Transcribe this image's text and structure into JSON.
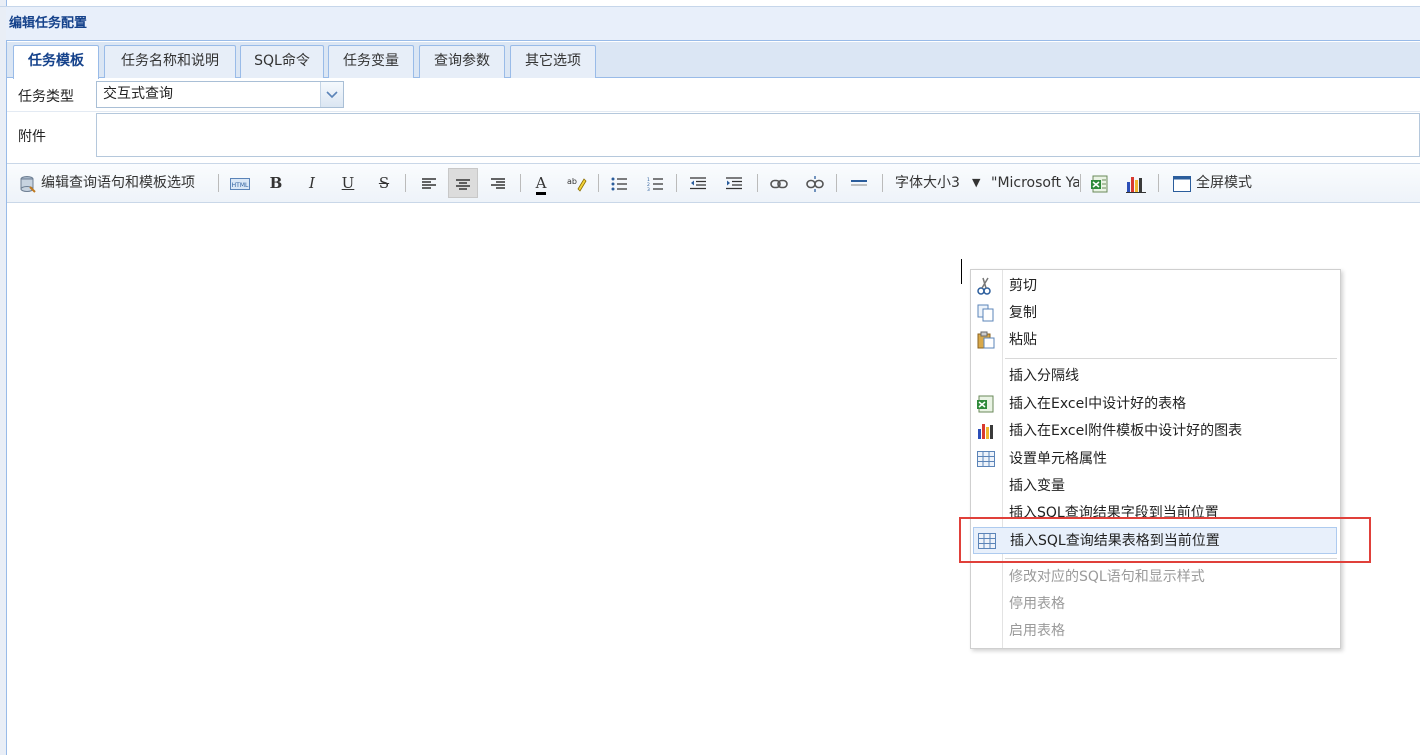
{
  "panel": {
    "title": "编辑任务配置"
  },
  "tabs": [
    {
      "label": "任务模板",
      "active": true
    },
    {
      "label": "任务名称和说明"
    },
    {
      "label": "SQL命令"
    },
    {
      "label": "任务变量"
    },
    {
      "label": "查询参数"
    },
    {
      "label": "其它选项"
    }
  ],
  "form": {
    "task_type_label": "任务类型",
    "task_type_value": "交互式查询",
    "attachment_label": "附件"
  },
  "toolbar": {
    "edit_query_label": "编辑查询语句和模板选项",
    "bold": "B",
    "italic": "I",
    "underline": "U",
    "strike": "S",
    "font_color": "A",
    "font_size_label": "字体大小3",
    "font_family_label": "\"Microsoft Ya",
    "fullscreen_label": "全屏模式"
  },
  "context_menu": {
    "items": [
      {
        "label": "剪切",
        "icon": "cut-icon"
      },
      {
        "label": "复制",
        "icon": "copy-icon"
      },
      {
        "label": "粘贴",
        "icon": "paste-icon"
      },
      {
        "label": "插入分隔线"
      },
      {
        "label": "插入在Excel中设计好的表格",
        "icon": "excel-icon"
      },
      {
        "label": "插入在Excel附件模板中设计好的图表",
        "icon": "chart-icon"
      },
      {
        "label": "设置单元格属性",
        "icon": "table-icon"
      },
      {
        "label": "插入变量"
      },
      {
        "label": "插入SQL查询结果字段到当前位置"
      },
      {
        "label": "插入SQL查询结果表格到当前位置",
        "icon": "table-icon",
        "hover": true
      },
      {
        "label": "修改对应的SQL语句和显示样式",
        "disabled": true
      },
      {
        "label": "停用表格",
        "disabled": true
      },
      {
        "label": "启用表格",
        "disabled": true
      }
    ]
  },
  "colors": {
    "accent": "#15428b",
    "highlight_border": "#e0403a",
    "menu_hover": "#e8f0fb"
  }
}
